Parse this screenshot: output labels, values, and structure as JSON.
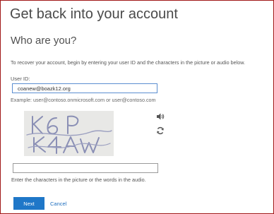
{
  "page": {
    "title": "Get back into your account",
    "subtitle": "Who are you?",
    "instructions": "To recover your account, begin by entering your user ID and the characters in the picture or audio below."
  },
  "user_id": {
    "label": "User ID:",
    "value": "coanew@boazk12.org",
    "example": "Example: user@contoso.onmicrosoft.com or user@contoso.com"
  },
  "captcha": {
    "image_text": "K6P K4AW",
    "audio_icon": "speaker-icon",
    "refresh_icon": "refresh-icon",
    "input_value": "",
    "hint": "Enter the characters in the picture or the words in the audio."
  },
  "actions": {
    "next_label": "Next",
    "cancel_label": "Cancel"
  },
  "colors": {
    "accent": "#1f77c8",
    "frame_border": "#a01818",
    "input_focus_border": "#5b8ed1"
  }
}
